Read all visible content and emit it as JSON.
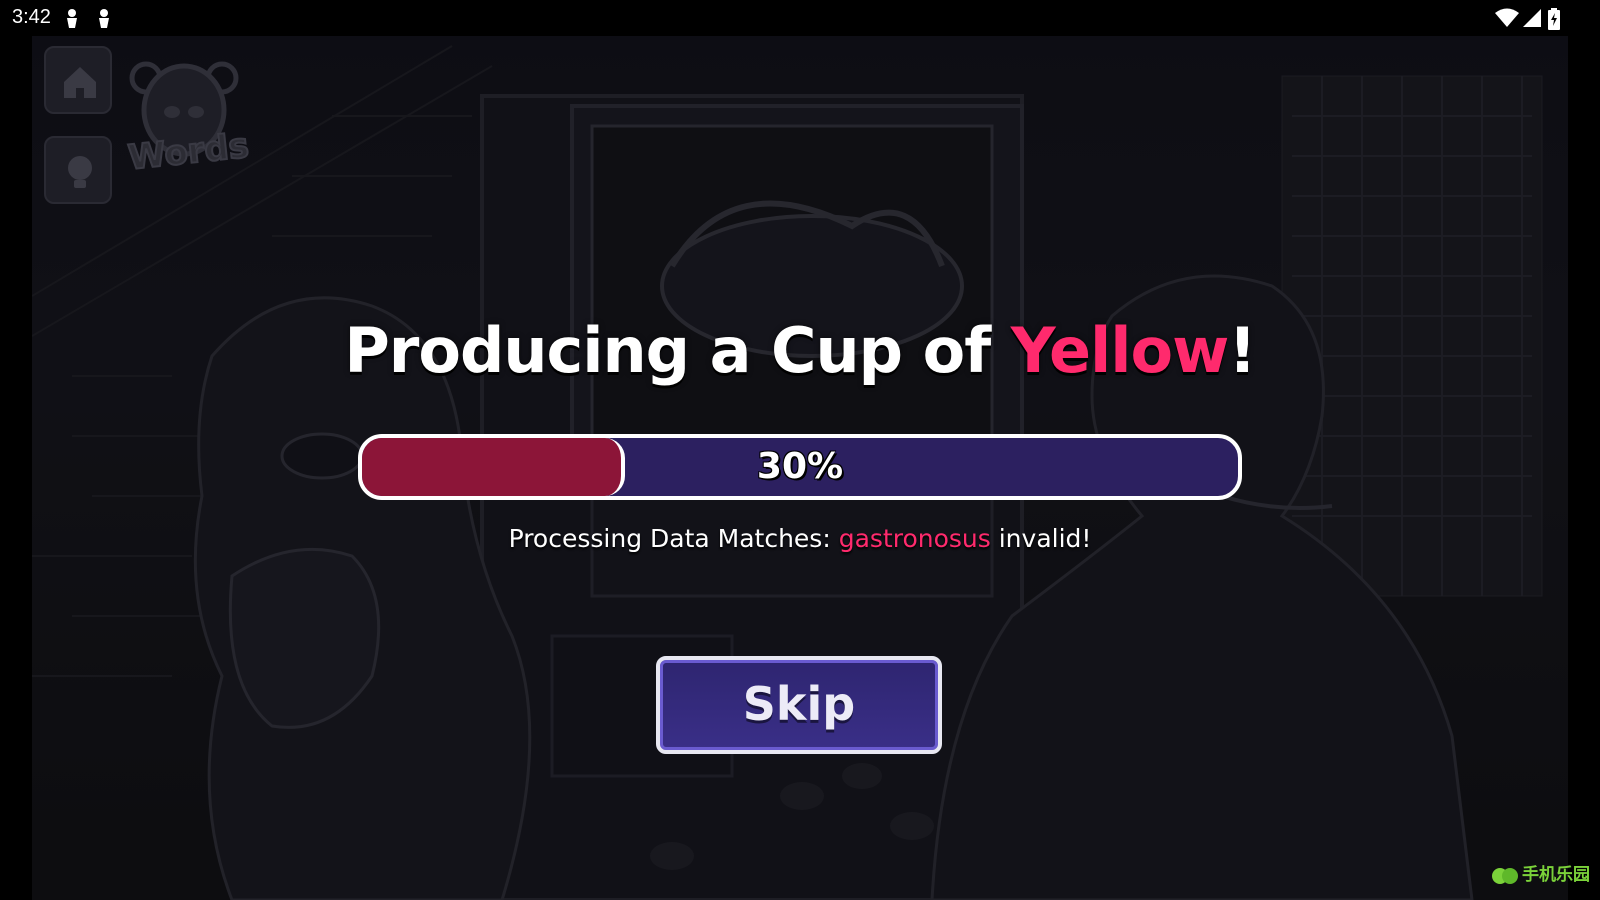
{
  "status_bar": {
    "time": "3:42"
  },
  "sidebar": {
    "home_icon": "home-icon",
    "hint_icon": "lightbulb-icon"
  },
  "logo": {
    "text": "Words"
  },
  "heading": {
    "prefix": "Producing a Cup of ",
    "highlight": "Yellow",
    "suffix": "!"
  },
  "progress": {
    "percent": 30,
    "label": "30%"
  },
  "processing": {
    "prefix": "Processing Data Matches: ",
    "word": "gastronosus",
    "suffix": " invalid!"
  },
  "actions": {
    "skip_label": "Skip"
  },
  "watermark": {
    "text": "手机乐园"
  },
  "colors": {
    "accent": "#ff2a6d",
    "progress_fill": "#8c1538",
    "progress_track": "#2c2060",
    "button_bg": "#2e2570"
  }
}
